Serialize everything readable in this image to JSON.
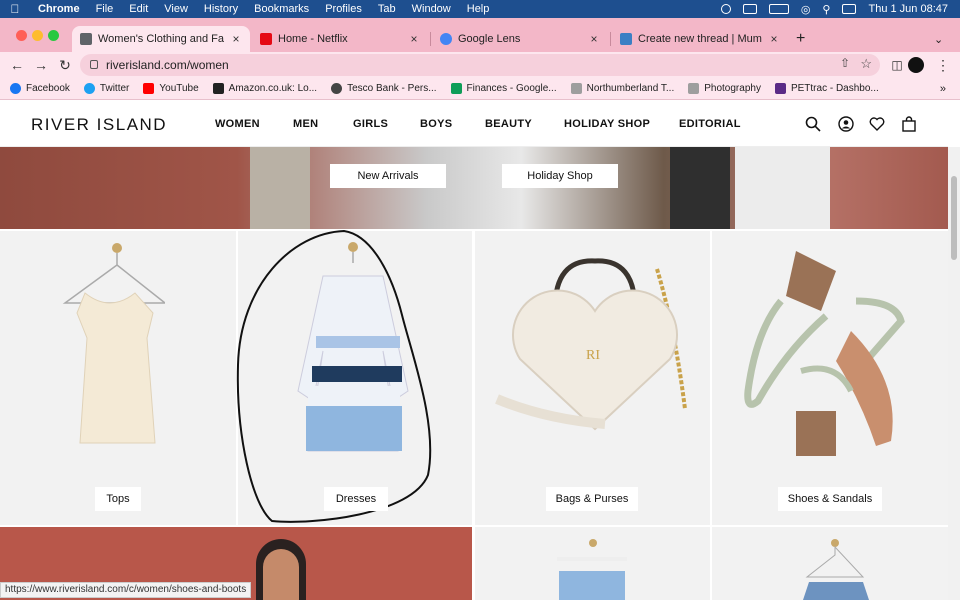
{
  "menubar": {
    "app": "Chrome",
    "items": [
      "File",
      "Edit",
      "View",
      "History",
      "Bookmarks",
      "Profiles",
      "Tab",
      "Window",
      "Help"
    ],
    "datetime": "Thu 1 Jun  08:47"
  },
  "tabs": [
    {
      "title": "Women's Clothing and Fashion",
      "color": "#5f6368"
    },
    {
      "title": "Home - Netflix",
      "color": "#e50914"
    },
    {
      "title": "Google Lens",
      "color": "#4285f4"
    },
    {
      "title": "Create new thread | Mumsnet",
      "color": "#3b7fc4"
    }
  ],
  "address": {
    "url": "riverisland.com/women"
  },
  "bookmarks": [
    {
      "label": "Facebook",
      "color": "#1877f2"
    },
    {
      "label": "Twitter",
      "color": "#1da1f2"
    },
    {
      "label": "YouTube",
      "color": "#ff0000"
    },
    {
      "label": "Amazon.co.uk: Lo...",
      "color": "#222222"
    },
    {
      "label": "Tesco Bank - Pers...",
      "color": "#444444"
    },
    {
      "label": "Finances - Google...",
      "color": "#0f9d58"
    },
    {
      "label": "Northumberland T...",
      "color": "#9e9e9e"
    },
    {
      "label": "Photography",
      "color": "#9e9e9e"
    },
    {
      "label": "PETtrac - Dashbo...",
      "color": "#5b2a86"
    }
  ],
  "site": {
    "logo": "RIVER ISLAND",
    "nav": [
      "WOMEN",
      "MEN",
      "GIRLS",
      "BOYS",
      "BEAUTY",
      "HOLIDAY SHOP",
      "EDITORIAL"
    ],
    "hero_buttons": [
      "New Arrivals",
      "Holiday Shop"
    ],
    "categories": [
      "Tops",
      "Dresses",
      "Bags & Purses",
      "Shoes & Sandals"
    ]
  },
  "status_url": "https://www.riverisland.com/c/women/shoes-and-boots"
}
